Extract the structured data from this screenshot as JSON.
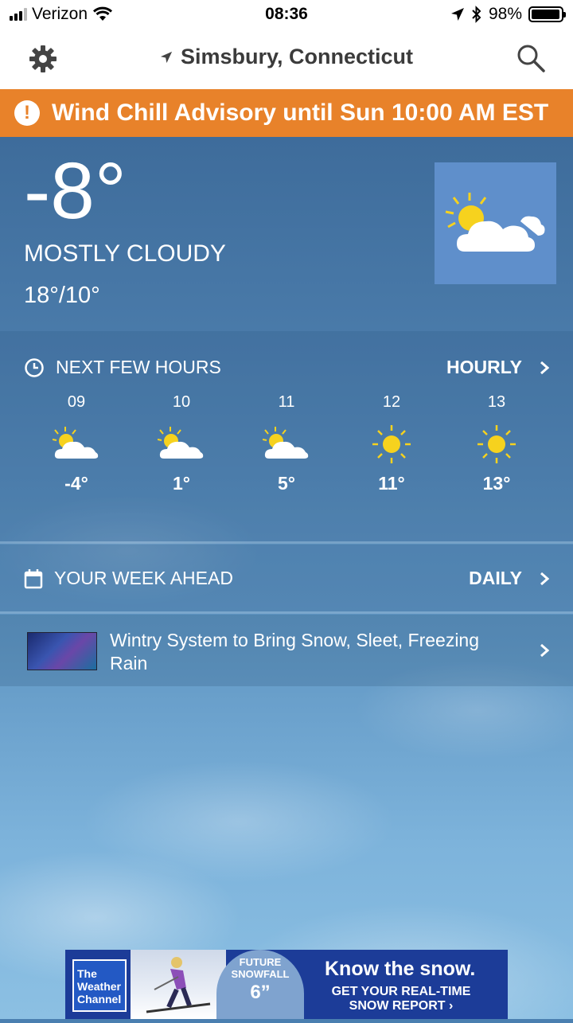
{
  "status_bar": {
    "carrier": "Verizon",
    "time": "08:36",
    "battery": "98%",
    "battery_level": 0.98
  },
  "header": {
    "location": "Simsbury, Connecticut",
    "settings_icon": "gear-icon",
    "search_icon": "search-icon"
  },
  "alert": {
    "icon": "exclamation-icon",
    "text": "Wind Chill Advisory until Sun 10:00 AM EST",
    "color": "#e8822a"
  },
  "current": {
    "temperature": "-8°",
    "condition": "MOSTLY CLOUDY",
    "hi_lo": "18°/10°",
    "icon": "partly-cloudy-icon"
  },
  "hourly": {
    "heading": "NEXT FEW HOURS",
    "link": "HOURLY",
    "hours": [
      {
        "hour": "09",
        "temp": "-4°",
        "icon": "partly-cloudy"
      },
      {
        "hour": "10",
        "temp": "1°",
        "icon": "partly-cloudy"
      },
      {
        "hour": "11",
        "temp": "5°",
        "icon": "partly-cloudy"
      },
      {
        "hour": "12",
        "temp": "11°",
        "icon": "sunny"
      },
      {
        "hour": "13",
        "temp": "13°",
        "icon": "sunny"
      }
    ]
  },
  "week": {
    "heading": "YOUR WEEK AHEAD",
    "link": "DAILY"
  },
  "news": {
    "title": "Wintry System to Bring Snow, Sleet, Freezing Rain"
  },
  "ad": {
    "logo": "The Weather Channel",
    "badge_line1": "FUTURE",
    "badge_line2": "SNOWFALL",
    "badge_value": "6”",
    "headline": "Know the snow.",
    "subline": "GET YOUR REAL-TIME SNOW REPORT ›"
  }
}
